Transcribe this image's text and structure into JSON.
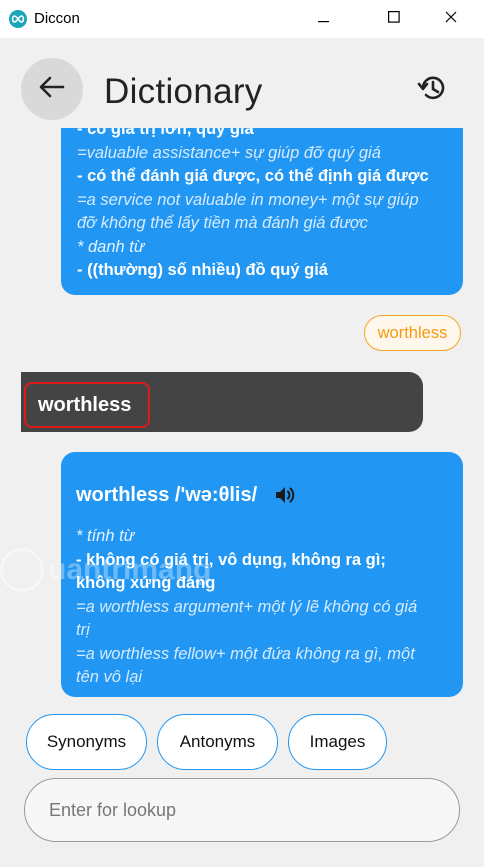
{
  "window": {
    "title": "Diccon"
  },
  "header": {
    "title": "Dictionary"
  },
  "icons": {
    "app": "infinity-icon",
    "back": "arrow-left-icon",
    "history": "history-icon",
    "speaker": "speaker-icon",
    "minimize": "minimize-icon",
    "maximize": "maximize-icon",
    "close": "close-icon"
  },
  "colors": {
    "bubble": "#2196f3",
    "user_bubble": "#444444",
    "query_chip": "#f5a623",
    "highlight": "#e01a1a"
  },
  "chat": {
    "previous_entry_lines": [
      {
        "style": "bold",
        "text": "- có giá trị lớn, quý giá"
      },
      {
        "style": "ital",
        "text": "=valuable assistance+ sự giúp đỡ quý giá"
      },
      {
        "style": "bold",
        "text": "- có thể đánh giá được, có thể định giá được"
      },
      {
        "style": "ital",
        "text": "=a service not valuable in money+ một sự giúp"
      },
      {
        "style": "ital",
        "text": "đỡ không thể lấy tiền mà đánh giá được"
      },
      {
        "style": "type",
        "text": "*  danh từ"
      },
      {
        "style": "bold",
        "text": "- ((thường) số nhiều) đồ quý giá"
      }
    ],
    "query_chip": "worthless",
    "user_message": "worthless",
    "result": {
      "headword": "worthless /'wə:θlis/",
      "lines": [
        {
          "style": "type",
          "text": "*  tính từ"
        },
        {
          "style": "bold",
          "text": "- không có giá trị, vô dụng, không ra gì;"
        },
        {
          "style": "bold",
          "text": "không xứng đáng"
        },
        {
          "style": "ital",
          "text": "=a worthless argument+ một lý lẽ không có giá"
        },
        {
          "style": "ital",
          "text": "trị"
        },
        {
          "style": "ital",
          "text": "=a worthless fellow+ một đứa không ra gì, một"
        },
        {
          "style": "ital",
          "text": "tên vô lại"
        }
      ]
    },
    "watermark": "uantrimang"
  },
  "chips": [
    {
      "label": "Synonyms"
    },
    {
      "label": "Antonyms"
    },
    {
      "label": "Images"
    }
  ],
  "search": {
    "placeholder": "Enter for lookup",
    "value": ""
  }
}
